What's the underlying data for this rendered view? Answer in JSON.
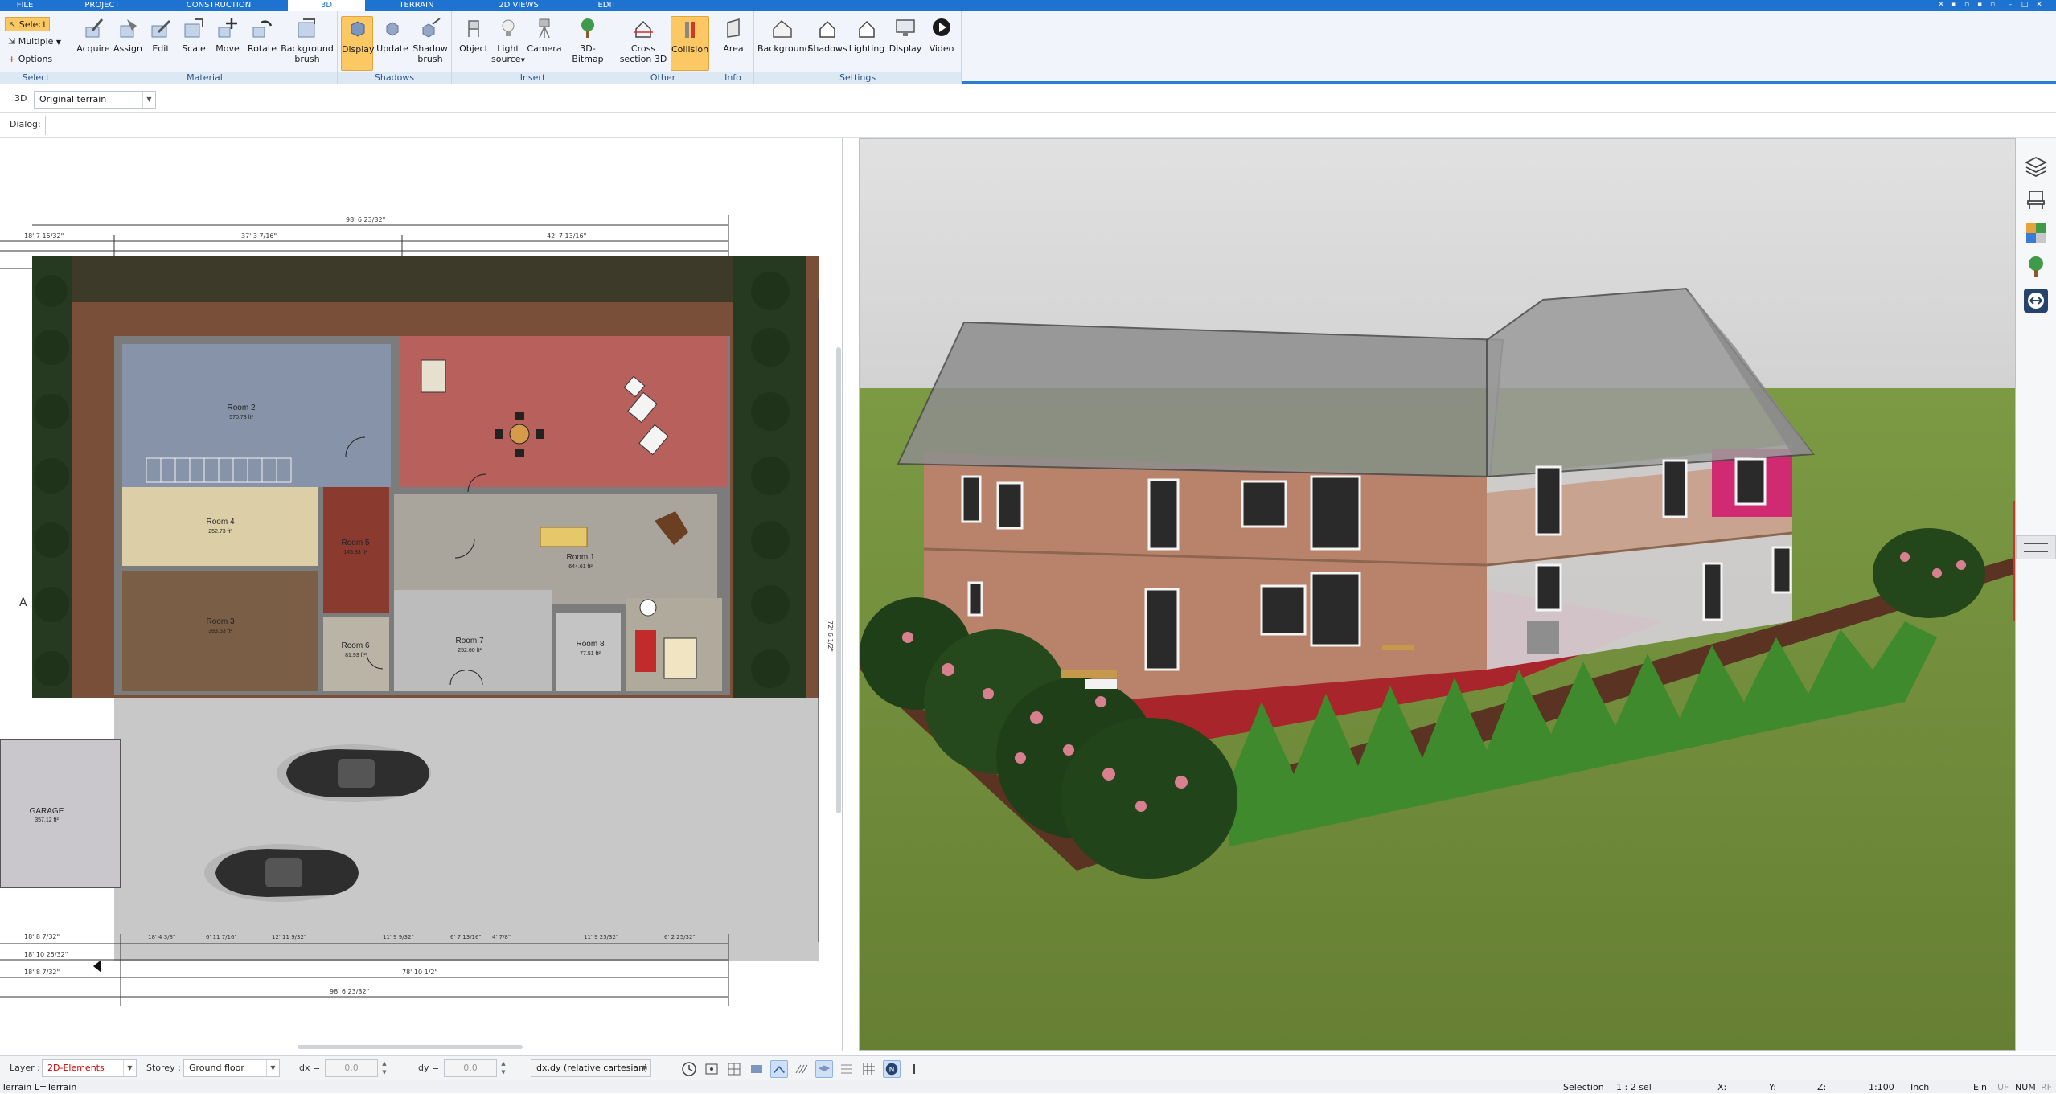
{
  "menu_tabs": [
    {
      "label": "FILE",
      "active": false
    },
    {
      "label": "PROJECT",
      "active": false
    },
    {
      "label": "CONSTRUCTION",
      "active": false
    },
    {
      "label": "3D",
      "active": true
    },
    {
      "label": "TERRAIN",
      "active": false
    },
    {
      "label": "2D VIEWS",
      "active": false
    },
    {
      "label": "EDIT",
      "active": false
    }
  ],
  "ribbon": {
    "select_group": {
      "label": "Select",
      "select": "Select",
      "multiple": "Multiple",
      "options": "Options"
    },
    "material_group": {
      "label": "Material",
      "buttons": [
        "Acquire",
        "Assign",
        "Edit",
        "Scale",
        "Move",
        "Rotate"
      ],
      "background_brush": [
        "Background",
        "brush"
      ]
    },
    "shadows_group": {
      "label": "Shadows",
      "display": "Display",
      "update": "Update",
      "shadow_brush": [
        "Shadow",
        "brush"
      ]
    },
    "insert_group": {
      "label": "Insert",
      "object": "Object",
      "light_source": [
        "Light",
        "source"
      ],
      "camera": "Camera",
      "bitmap": "3D-Bitmap"
    },
    "other_group": {
      "label": "Other",
      "cross_section": [
        "Cross",
        "section 3D"
      ],
      "collision": "Collision"
    },
    "info_group": {
      "label": "Info",
      "area": "Area"
    },
    "settings_group": {
      "label": "Settings",
      "buttons": [
        "Background",
        "Shadows",
        "Lighting",
        "Display",
        "Video"
      ]
    }
  },
  "subbar": {
    "view_label": "3D",
    "terrain_select": "Original terrain",
    "dialog_label": "Dialog:"
  },
  "plan": {
    "dims_top": [
      "98' 6 23/32\"",
      "18' 7 15/32\"",
      "37' 3 7/16\"",
      "42' 7 13/16\""
    ],
    "dims_bottom": [
      "18' 8 7/32\"",
      "18' 10 25/32\"",
      "18' 8 7/32\"",
      "78' 10 1/2\"",
      "98' 6 23/32\""
    ],
    "dims_bottom_row": [
      "18' 4 3/8\"",
      "6' 11 7/16\"",
      "12' 11 9/32\"",
      "11' 9 9/32\"",
      "6' 7 13/16\"",
      "4' 7/8\"",
      "11' 9 25/32\"",
      "6' 2 25/32\""
    ],
    "dim_right": "72' 6 1/2\"",
    "rooms": [
      {
        "name": "Room 2",
        "area": "570.73 ft²"
      },
      {
        "name": "Room 4",
        "area": "252.73 ft²"
      },
      {
        "name": "Room 5",
        "area": "145.33 ft²"
      },
      {
        "name": "Room 1",
        "area": "644.61 ft²"
      },
      {
        "name": "Room 3",
        "area": "383.53 ft²"
      },
      {
        "name": "Room 6",
        "area": "81.93 ft²"
      },
      {
        "name": "Room 7",
        "area": "252.60 ft²"
      },
      {
        "name": "Room 8",
        "area": "77.51 ft²"
      },
      {
        "name": "GARAGE",
        "area": "357.12 ft²"
      }
    ],
    "section_marker": "A"
  },
  "statusbar": {
    "layer_label": "Layer :",
    "layer_value": "2D-Elements",
    "storey_label": "Storey :",
    "storey_value": "Ground floor",
    "dx_label": "dx =",
    "dx_value": "0.0",
    "dy_label": "dy =",
    "dy_value": "0.0",
    "coord_mode": "dx,dy (relative cartesian)"
  },
  "bottombar": {
    "left_text": "Terrain L=Terrain",
    "selection_label": "Selection",
    "selection_value": "1 : 2 sel",
    "x_label": "X:",
    "y_label": "Y:",
    "z_label": "Z:",
    "scale": "1:100",
    "unit": "Inch",
    "ein": "Ein",
    "uf": "UF",
    "num": "NUM",
    "rf": "RF"
  },
  "colors": {
    "accent_blue": "#1e72d0",
    "active_button": "#fbc864",
    "grass": "#6f8e3a",
    "sky": "#dcdcdc",
    "layer_red": "#d40000"
  },
  "side_tools": [
    "layers-icon",
    "furniture-icon",
    "materials-icon",
    "plant-icon",
    "transfer-icon"
  ]
}
